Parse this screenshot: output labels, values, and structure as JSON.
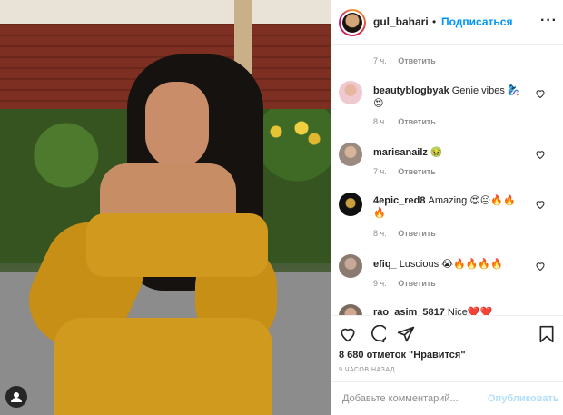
{
  "post": {
    "username": "gul_bahari",
    "separator": "•",
    "follow_label": "Подписаться",
    "more_label": "···"
  },
  "comments": [
    {
      "username": "",
      "text": "",
      "time": "7 ч.",
      "reply": "Ответить"
    },
    {
      "username": "beautyblogbyak",
      "text": "Genie vibes 🧞‍♀️ 😍",
      "time": "8 ч.",
      "reply": "Ответить"
    },
    {
      "username": "marisanailz",
      "text": "🤢",
      "time": "7 ч.",
      "reply": "Ответить"
    },
    {
      "username": "4epic_red8",
      "text": "Amazing 😍😐🔥🔥 🔥",
      "time": "8 ч.",
      "reply": "Ответить"
    },
    {
      "username": "efiq_",
      "text": "Luscious 😭🔥🔥🔥🔥",
      "time": "9 ч.",
      "reply": "Ответить"
    },
    {
      "username": "rao_asim_5817",
      "text": "Nice❤️❤️",
      "time": "",
      "reply": ""
    }
  ],
  "likes_text": "8 680 отметок \"Нравится\"",
  "time_ago": "9 ЧАСОВ НАЗАД",
  "comment_input": {
    "placeholder": "Добавьте комментарий..."
  },
  "publish_label": "Опубликовать",
  "colors": {
    "follow": "#0095f6",
    "publish_disabled": "#b2dffc",
    "meta": "#8e8e8e"
  },
  "icons": [
    "heart-icon",
    "comment-icon",
    "share-icon",
    "bookmark-icon",
    "more-icon",
    "user-tag-icon"
  ]
}
